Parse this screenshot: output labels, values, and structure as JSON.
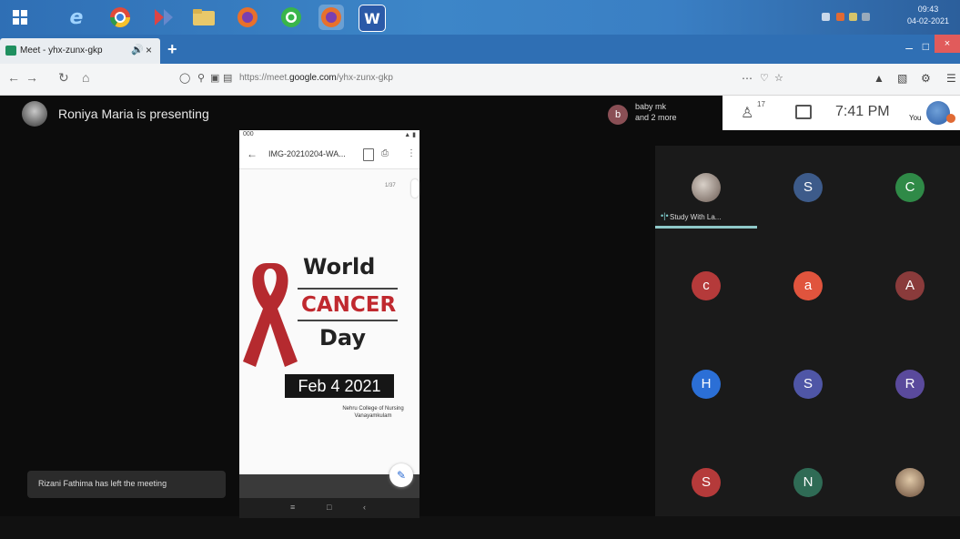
{
  "taskbar": {
    "icons": [
      "windows-start-icon",
      "edge-icon",
      "chrome-icon",
      "media-icon",
      "folder-icon",
      "firefox-icon",
      "whatsapp-icon",
      "firefox-icon-2",
      "word-icon"
    ],
    "word_glyph": "W",
    "clock_time": "09:43",
    "clock_date": "04-02-2021"
  },
  "browser": {
    "tab_title": "Meet - yhx-zunx-gkp",
    "url_host": "https://meet.",
    "url_domain": "google.com",
    "url_path": "/yhx-zunx-gkp"
  },
  "meet": {
    "presenter_text": "Roniya Maria is presenting",
    "top_people_initial": "b",
    "top_people_line1": "baby mk",
    "top_people_line2": "and 2 more",
    "people_count": "17",
    "time": "7:41 PM",
    "you_label": "You",
    "notification": "Rizani Fathima has left the meeting",
    "participants": [
      {
        "initial": "",
        "name": "Study With La...",
        "color": "#555555"
      },
      {
        "initial": "S",
        "color": "#3d5b8a"
      },
      {
        "initial": "C",
        "color": "#2f8a47"
      },
      {
        "initial": "c",
        "color": "#b53a3a"
      },
      {
        "initial": "a",
        "color": "#e0543d"
      },
      {
        "initial": "A",
        "color": "#8a3b3b"
      },
      {
        "initial": "H",
        "color": "#2b6fd6"
      },
      {
        "initial": "S",
        "color": "#4f56a6"
      },
      {
        "initial": "R",
        "color": "#5a4a9c"
      },
      {
        "initial": "S",
        "color": "#b53a3a"
      },
      {
        "initial": "N",
        "color": "#2f6b55"
      },
      {
        "initial": "",
        "color": "#6a4d3a"
      }
    ]
  },
  "phone": {
    "status_left": "000",
    "file_name": "IMG-20210204-WA...",
    "page_indicator": "1/37",
    "poster_world": "World",
    "poster_cancer": "CANCER",
    "poster_day": "Day",
    "poster_date": "Feb 4 2021",
    "poster_college_line1": "Nehru College of Nursing",
    "poster_college_line2": "Vanayamkulam"
  },
  "colors": {
    "taskbar": "#3a7fc4",
    "meet_bg": "#0c0c0c",
    "cancer_red": "#c0292f"
  }
}
